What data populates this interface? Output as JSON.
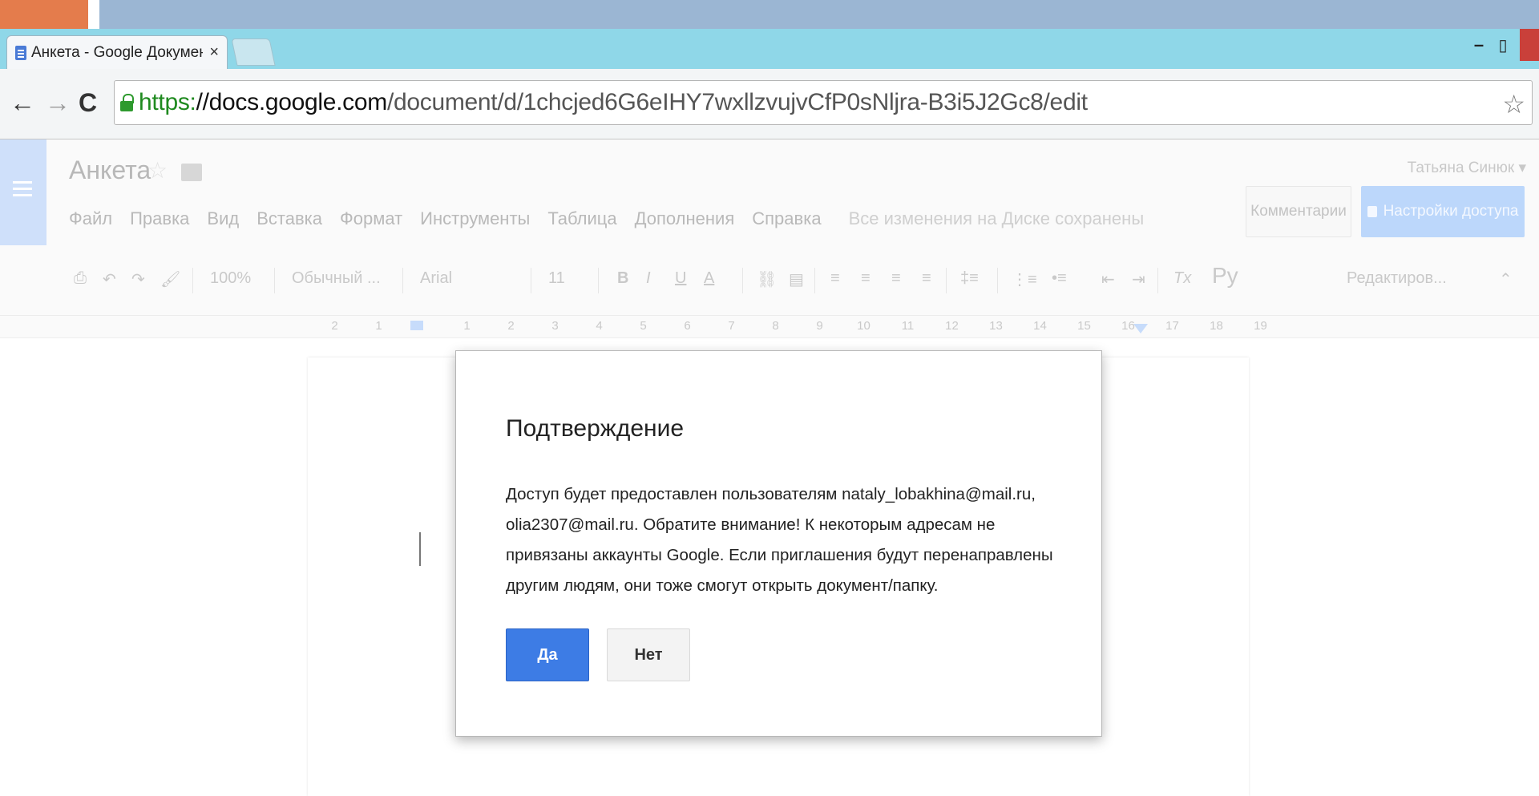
{
  "browser": {
    "tab_title": "Анкета - Google Докумен",
    "tab_close": "×",
    "url_scheme": "https:",
    "url_host": "//docs.google.com",
    "url_path": "/document/d/1chcjed6G6eIHY7wxllzvujvCfP0sNljra-B3i5J2Gc8/edit",
    "back": "←",
    "forward": "→",
    "reload": "C",
    "bookmark_star": "☆",
    "minimize": "–",
    "maximize": "▯"
  },
  "docs": {
    "title": "Анкета",
    "title_star": "☆",
    "user": "Татьяна Синюк ▾",
    "menu": [
      "Файл",
      "Правка",
      "Вид",
      "Вставка",
      "Формат",
      "Инструменты",
      "Таблица",
      "Дополнения",
      "Справка"
    ],
    "save_status": "Все изменения на Диске сохранены",
    "comments_label": "Комментарии",
    "share_label": "Настройки доступа"
  },
  "toolbar": {
    "print_icon": "⎙",
    "undo_icon": "↶",
    "redo_icon": "↷",
    "paint_icon": "🖌",
    "zoom": "100%",
    "style": "Обычный ...",
    "font": "Arial",
    "size": "11",
    "bold": "B",
    "italic": "I",
    "underline": "U",
    "text_color": "A",
    "link_icon": "⛓",
    "comment_icon": "▤",
    "align_left": "≡",
    "align_center": "≡",
    "align_right": "≡",
    "align_justify": "≡",
    "line_spacing": "‡≡",
    "numbered_list": "⋮≡",
    "bulleted_list": "•≡",
    "decrease_indent": "⇤",
    "increase_indent": "⇥",
    "clear_format": "Tx",
    "input_tools": "Ру",
    "mode": "Редактиров...",
    "collapse": "⌃"
  },
  "ruler": [
    "2",
    "1",
    "",
    "1",
    "2",
    "3",
    "4",
    "5",
    "6",
    "7",
    "8",
    "9",
    "10",
    "11",
    "12",
    "13",
    "14",
    "15",
    "16",
    "17",
    "18",
    "19"
  ],
  "dialog": {
    "title": "Подтверждение",
    "body": "Доступ будет предоставлен пользователям nataly_lobakhina@mail.ru, olia2307@mail.ru. Обратите внимание! К некоторым адресам не привязаны аккаунты Google. Если приглашения будут перенаправлены другим людям, они тоже смогут открыть документ/папку.",
    "yes_label": "Да",
    "no_label": "Нет"
  }
}
